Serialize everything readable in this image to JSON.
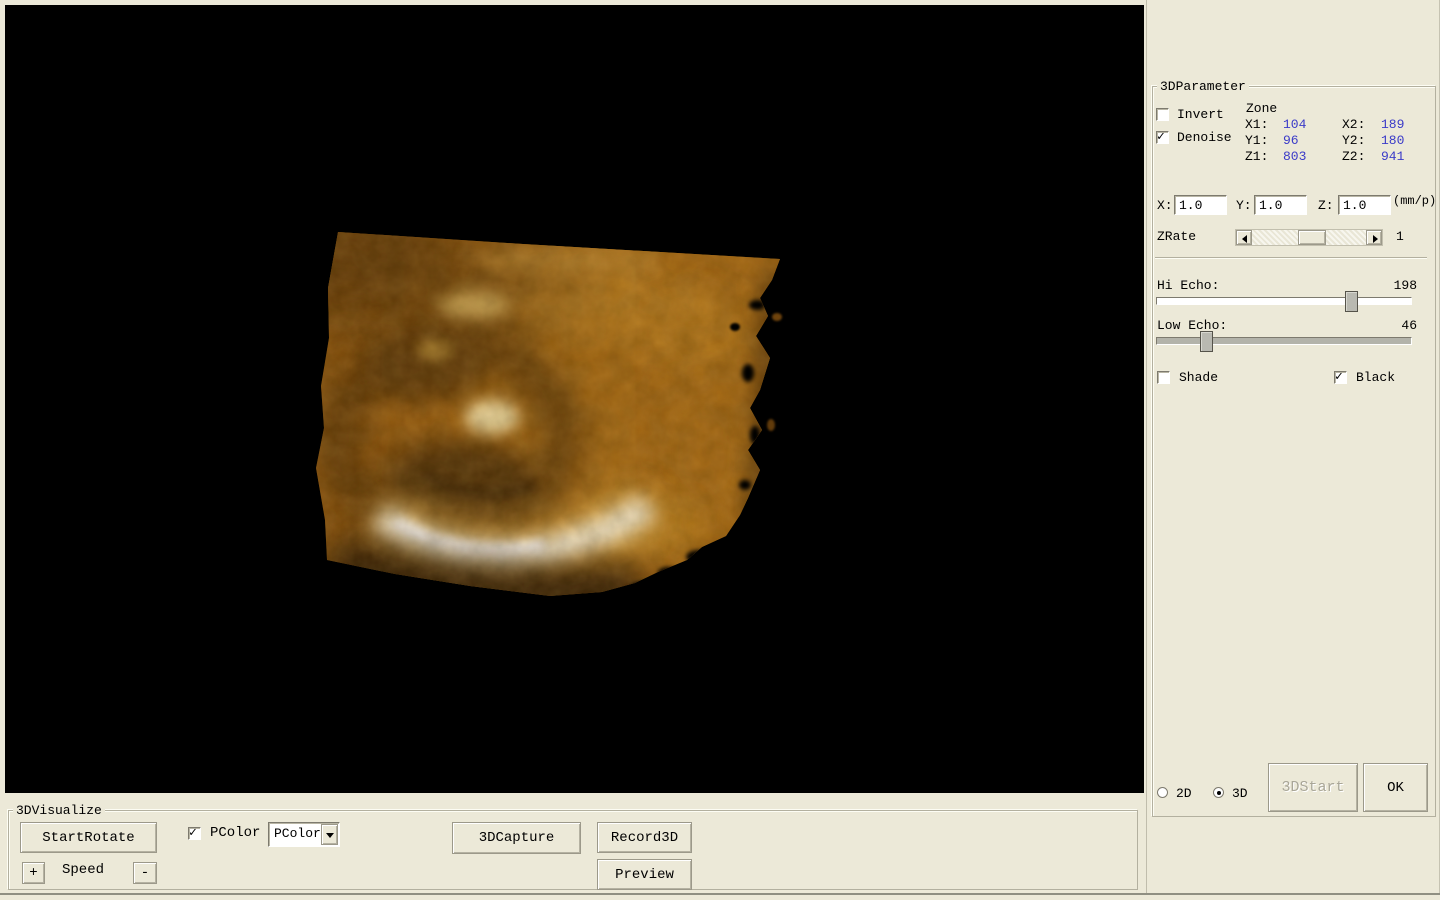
{
  "colors": {
    "panel_bg": "#ece9d8",
    "viewport_bg": "#000000",
    "zone_value_color": "#3a3ac8"
  },
  "param_panel": {
    "group_label": "3DParameter",
    "invert": {
      "label": "Invert",
      "checked": false
    },
    "denoise": {
      "label": "Denoise",
      "checked": true
    },
    "zone": {
      "label": "Zone",
      "fields": [
        {
          "label": "X1:",
          "value": "104"
        },
        {
          "label": "X2:",
          "value": "189"
        },
        {
          "label": "Y1:",
          "value": "96"
        },
        {
          "label": "Y2:",
          "value": "180"
        },
        {
          "label": "Z1:",
          "value": "803"
        },
        {
          "label": "Z2:",
          "value": "941"
        }
      ]
    },
    "scale": {
      "x_label": "X:",
      "x_value": "1.0",
      "y_label": "Y:",
      "y_value": "1.0",
      "z_label": "Z:",
      "z_value": "1.0",
      "unit": "(mm/p)"
    },
    "zrate": {
      "label": "ZRate",
      "value": "1"
    },
    "hi_echo": {
      "label": "Hi Echo:",
      "value": "198",
      "max": 255
    },
    "low_echo": {
      "label": "Low Echo:",
      "value": "46",
      "max": 255
    },
    "shade": {
      "label": "Shade",
      "checked": false
    },
    "black": {
      "label": "Black",
      "checked": true
    },
    "mode_2d": {
      "label": "2D",
      "selected": false
    },
    "mode_3d": {
      "label": "3D",
      "selected": true
    },
    "start_button": {
      "label": "3DStart",
      "enabled": false
    },
    "ok_button": {
      "label": "OK"
    }
  },
  "visualize_panel": {
    "group_label": "3DVisualize",
    "start_rotate_button": "StartRotate",
    "pcolor_check": {
      "label": "PColor",
      "checked": true
    },
    "pcolor_select": {
      "value": "PColor"
    },
    "capture_button": "3DCapture",
    "record_button": "Record3D",
    "preview_button": "Preview",
    "speed": {
      "label": "Speed",
      "plus": "+",
      "minus": "-"
    }
  }
}
